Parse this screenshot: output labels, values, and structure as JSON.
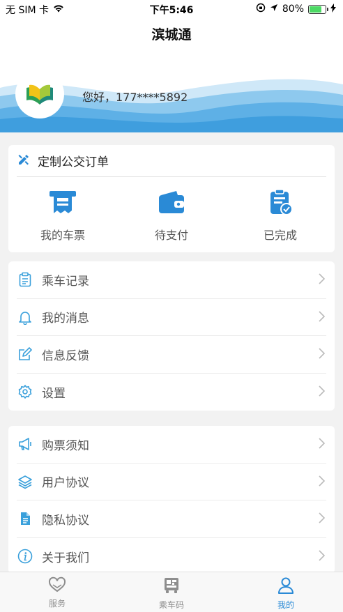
{
  "status_bar": {
    "carrier": "无 SIM 卡",
    "time": "下午5:46",
    "battery": "80%",
    "battery_level": 0.8
  },
  "app_title": "滨城通",
  "profile": {
    "greeting": "您好，177****5892"
  },
  "order_card": {
    "title": "定制公交订单",
    "items": [
      {
        "label": "我的车票",
        "icon": "ticket-icon"
      },
      {
        "label": "待支付",
        "icon": "wallet-icon"
      },
      {
        "label": "已完成",
        "icon": "clipboard-check-icon"
      }
    ]
  },
  "menu1": [
    {
      "label": "乘车记录",
      "icon": "clipboard-icon"
    },
    {
      "label": "我的消息",
      "icon": "bell-icon"
    },
    {
      "label": "信息反馈",
      "icon": "edit-icon"
    },
    {
      "label": "设置",
      "icon": "gear-icon"
    }
  ],
  "menu2": [
    {
      "label": "购票须知",
      "icon": "megaphone-icon"
    },
    {
      "label": "用户协议",
      "icon": "layers-icon"
    },
    {
      "label": "隐私协议",
      "icon": "document-icon"
    },
    {
      "label": "关于我们",
      "icon": "info-icon"
    }
  ],
  "tabs": [
    {
      "label": "服务",
      "icon": "heart-icon"
    },
    {
      "label": "乘车码",
      "icon": "bus-code-icon"
    },
    {
      "label": "我的",
      "icon": "person-icon",
      "active": true
    }
  ],
  "colors": {
    "accent": "#2a8ad6",
    "icon_blue": "#3aa0db",
    "wave_light": "#8ec9ee",
    "wave_dark": "#3f9ede"
  }
}
